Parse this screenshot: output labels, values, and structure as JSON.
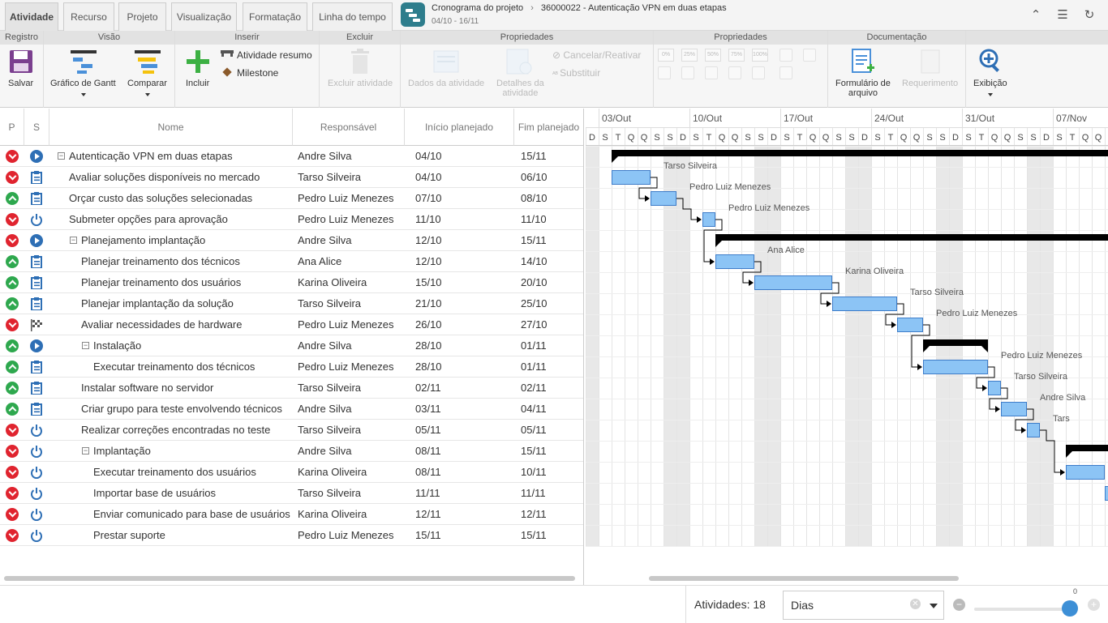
{
  "tabs": [
    {
      "label": "Atividade",
      "active": true
    },
    {
      "label": "Recurso"
    },
    {
      "label": "Projeto"
    },
    {
      "label": "Visualização"
    },
    {
      "label": "Formatação"
    },
    {
      "label": "Linha do tempo"
    }
  ],
  "breadcrumb": {
    "root": "Cronograma do projeto",
    "sep": "›",
    "current": "36000022 - Autenticação VPN em duas etapas",
    "period": "04/10 - 16/11"
  },
  "ribbon": {
    "groups": [
      "Registro",
      "Visão",
      "Inserir",
      "Excluir",
      "Propriedades",
      "Propriedades",
      "Documentação"
    ],
    "save": "Salvar",
    "gantt": "Gráfico de Gantt",
    "compare": "Comparar",
    "include": "Incluir",
    "summary": "Atividade resumo",
    "milestone": "Milestone",
    "delete": "Excluir atividade",
    "activity_data": "Dados da atividade",
    "activity_details": [
      "Detalhes da",
      "atividade"
    ],
    "cancel": "Cancelar/Reativar",
    "replace": "Substituir",
    "file_form": [
      "Formulário de",
      "arquivo"
    ],
    "requirement": "Requerimento",
    "view": "Exibição",
    "pct": [
      "0%",
      "25%",
      "50%",
      "75%",
      "100%"
    ]
  },
  "grid": {
    "headers": [
      "P",
      "S",
      "Nome",
      "Responsável",
      "Início planejado",
      "Fim planejado"
    ],
    "rows": [
      {
        "p": "down",
        "s": "play",
        "level": 0,
        "toggle": "−",
        "name": "Autenticação VPN em duas etapas",
        "resp": "Andre Silva",
        "start": "04/10",
        "end": "15/11"
      },
      {
        "p": "down",
        "s": "clip",
        "level": 1,
        "name": "Avaliar soluções disponíveis no mercado",
        "resp": "Tarso Silveira",
        "start": "04/10",
        "end": "06/10"
      },
      {
        "p": "up",
        "s": "clip",
        "level": 1,
        "name": "Orçar custo das soluções selecionadas",
        "resp": "Pedro Luiz Menezes",
        "start": "07/10",
        "end": "08/10"
      },
      {
        "p": "down",
        "s": "power",
        "level": 1,
        "name": "Submeter opções para aprovação",
        "resp": "Pedro Luiz Menezes",
        "start": "11/10",
        "end": "11/10"
      },
      {
        "p": "down",
        "s": "play",
        "level": 1,
        "toggle": "−",
        "name": "Planejamento implantação",
        "resp": "Andre Silva",
        "start": "12/10",
        "end": "15/11"
      },
      {
        "p": "up",
        "s": "clip",
        "level": 2,
        "name": "Planejar treinamento dos técnicos",
        "resp": "Ana Alice",
        "start": "12/10",
        "end": "14/10"
      },
      {
        "p": "up",
        "s": "clip",
        "level": 2,
        "name": "Planejar treinamento dos usuários",
        "resp": "Karina Oliveira",
        "start": "15/10",
        "end": "20/10"
      },
      {
        "p": "up",
        "s": "clip",
        "level": 2,
        "name": "Planejar implantação da solução",
        "resp": "Tarso Silveira",
        "start": "21/10",
        "end": "25/10"
      },
      {
        "p": "down",
        "s": "flag",
        "level": 2,
        "name": "Avaliar necessidades de hardware",
        "resp": "Pedro Luiz Menezes",
        "start": "26/10",
        "end": "27/10"
      },
      {
        "p": "up",
        "s": "play",
        "level": 2,
        "toggle": "−",
        "name": "Instalação",
        "resp": "Andre Silva",
        "start": "28/10",
        "end": "01/11"
      },
      {
        "p": "up",
        "s": "clip",
        "level": 3,
        "name": "Executar treinamento dos técnicos",
        "resp": "Pedro Luiz Menezes",
        "start": "28/10",
        "end": "01/11"
      },
      {
        "p": "up",
        "s": "clip",
        "level": 2,
        "name": "Instalar software no servidor",
        "resp": "Tarso Silveira",
        "start": "02/11",
        "end": "02/11"
      },
      {
        "p": "up",
        "s": "clip",
        "level": 2,
        "name": "Criar grupo para teste envolvendo técnicos",
        "resp": "Andre Silva",
        "start": "03/11",
        "end": "04/11"
      },
      {
        "p": "down",
        "s": "power",
        "level": 2,
        "name": "Realizar correções encontradas no teste",
        "resp": "Tarso Silveira",
        "start": "05/11",
        "end": "05/11"
      },
      {
        "p": "down",
        "s": "power",
        "level": 2,
        "toggle": "−",
        "name": "Implantação",
        "resp": "Andre Silva",
        "start": "08/11",
        "end": "15/11"
      },
      {
        "p": "down",
        "s": "power",
        "level": 3,
        "name": "Executar treinamento dos usuários",
        "resp": "Karina Oliveira",
        "start": "08/11",
        "end": "10/11"
      },
      {
        "p": "down",
        "s": "power",
        "level": 3,
        "name": "Importar base de usuários",
        "resp": "Tarso Silveira",
        "start": "11/11",
        "end": "11/11"
      },
      {
        "p": "down",
        "s": "power",
        "level": 3,
        "name": "Enviar comunicado para base de usuários",
        "resp": "Karina Oliveira",
        "start": "12/11",
        "end": "12/11"
      },
      {
        "p": "down",
        "s": "power",
        "level": 3,
        "name": "Prestar suporte",
        "resp": "Pedro Luiz Menezes",
        "start": "15/11",
        "end": "15/11"
      }
    ]
  },
  "gantt": {
    "weeks": [
      "03/Out",
      "10/Out",
      "17/Out",
      "24/Out",
      "31/Out",
      "07/Nov"
    ],
    "days": [
      "D",
      "S",
      "T",
      "Q",
      "Q",
      "S",
      "S"
    ],
    "bar_labels": [
      "Tarso Silveira",
      "Pedro Luiz Menezes",
      "Pedro Luiz Menezes",
      "Ana Alice",
      "Karina Oliveira",
      "Tarso Silveira",
      "Pedro Luiz Menezes",
      "Pedro Luiz Menezes",
      "Tarso Silveira",
      "Andre Silva",
      "Tars"
    ],
    "colors": {
      "bar": "#8cc4f5",
      "bar_border": "#3d7cc9",
      "summary": "#000000",
      "weekend": "#e8e8e8"
    }
  },
  "status": {
    "count_label": "Atividades: 18",
    "zoom_unit": "Dias",
    "zoom_value": "0"
  }
}
